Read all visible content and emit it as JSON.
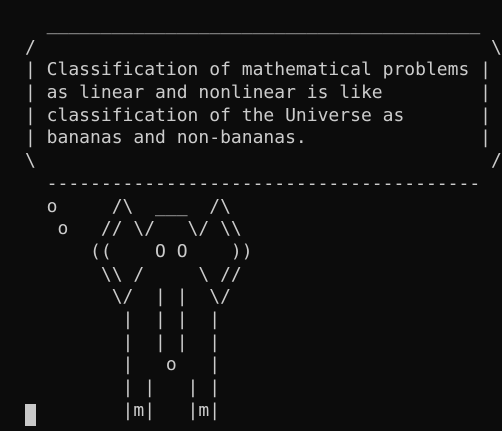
{
  "terminal": {
    "colors": {
      "background": "#0c0c0c",
      "foreground": "#cccccc",
      "cursor": "#c9c9c9"
    },
    "lines": [
      "  ________________________________________",
      "/                                          \\",
      "| Classification of mathematical problems |",
      "| as linear and nonlinear is like         |",
      "| classification of the Universe as       |",
      "| bananas and non-bananas.                |",
      "\\                                          /",
      "  ----------------------------------------",
      "  o     /\\  ___  /\\",
      "   o   // \\/   \\/ \\\\",
      "      ((    O O    ))",
      "       \\\\ /     \\ //",
      "        \\/  | |  \\/",
      "         |  | |  |",
      "         |  | |  |",
      "         |   o   |",
      "         | |   | |",
      "         |m|   |m|"
    ]
  }
}
